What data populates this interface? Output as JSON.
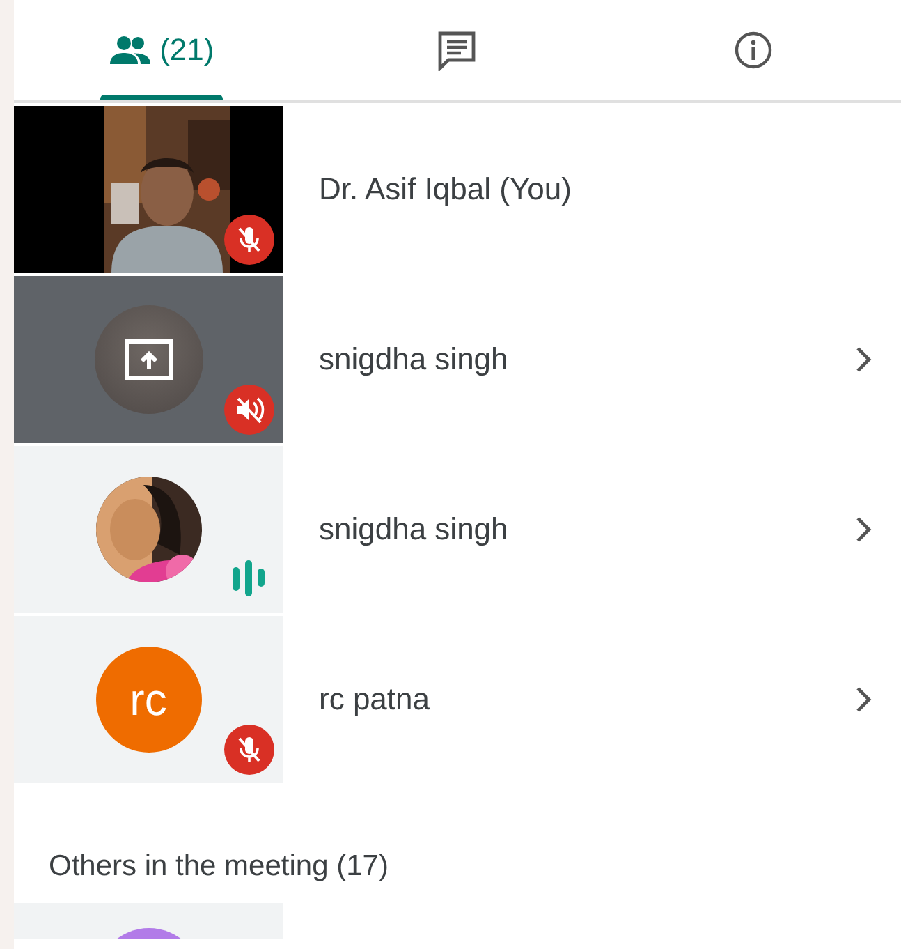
{
  "tabs": [
    {
      "kind": "people",
      "label": "(21)",
      "selected": true
    },
    {
      "kind": "chat",
      "selected": false
    },
    {
      "kind": "info",
      "selected": false
    }
  ],
  "participants": [
    {
      "name": "Dr. Asif Iqbal (You)",
      "kind": "video",
      "mic_muted": true,
      "chevron": false
    },
    {
      "name": "snigdha singh",
      "kind": "screen_share",
      "sound_muted": true,
      "chevron": true
    },
    {
      "name": "snigdha singh",
      "speaking": true,
      "chevron": true
    },
    {
      "name": "rc patna",
      "kind": "initials",
      "initials": "rc",
      "color": "#ef6c00",
      "mic_muted": true,
      "chevron": true
    }
  ],
  "others": {
    "heading": "Others in the meeting (17)",
    "participants": [
      {
        "kind": "initials",
        "color": "#b27be8"
      }
    ]
  }
}
